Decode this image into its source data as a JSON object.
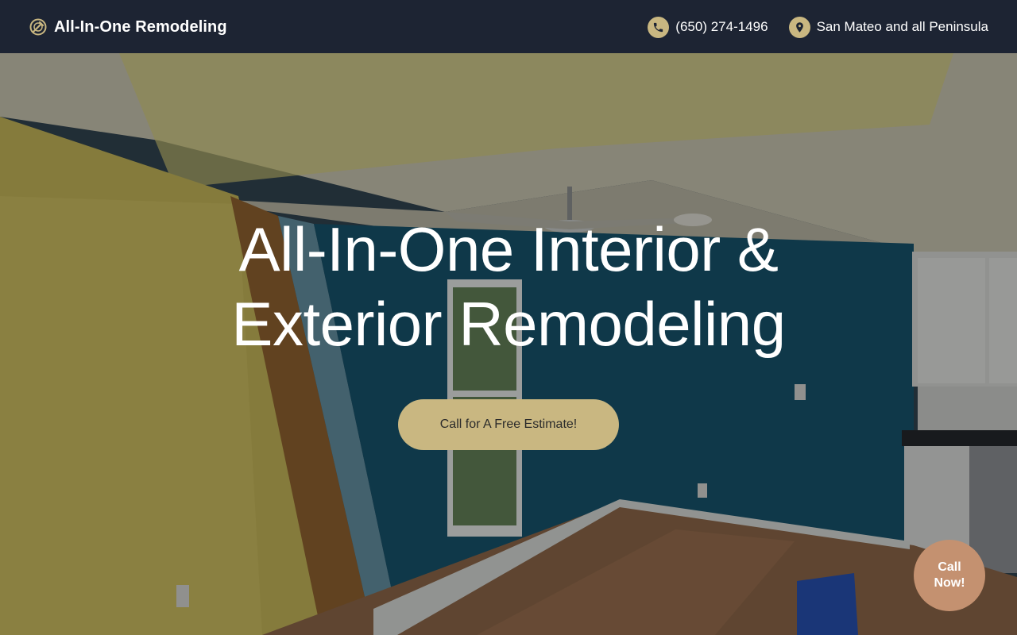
{
  "header": {
    "brand_name": "All-In-One Remodeling",
    "phone": "(650) 274-1496",
    "service_area": "San Mateo and all Peninsula",
    "brand_icon": "compass-hammer-icon",
    "phone_icon": "phone-icon",
    "location_icon": "map-pin-icon"
  },
  "hero": {
    "headline": "All-In-One Interior & Exterior Remodeling",
    "cta_label": "Call for A Free Estimate!"
  },
  "floating": {
    "call_now_label": "Call\nNow!"
  },
  "colors": {
    "header_bg": "#1d2433",
    "accent": "#c9b781",
    "call_now_bg": "#c49170"
  }
}
